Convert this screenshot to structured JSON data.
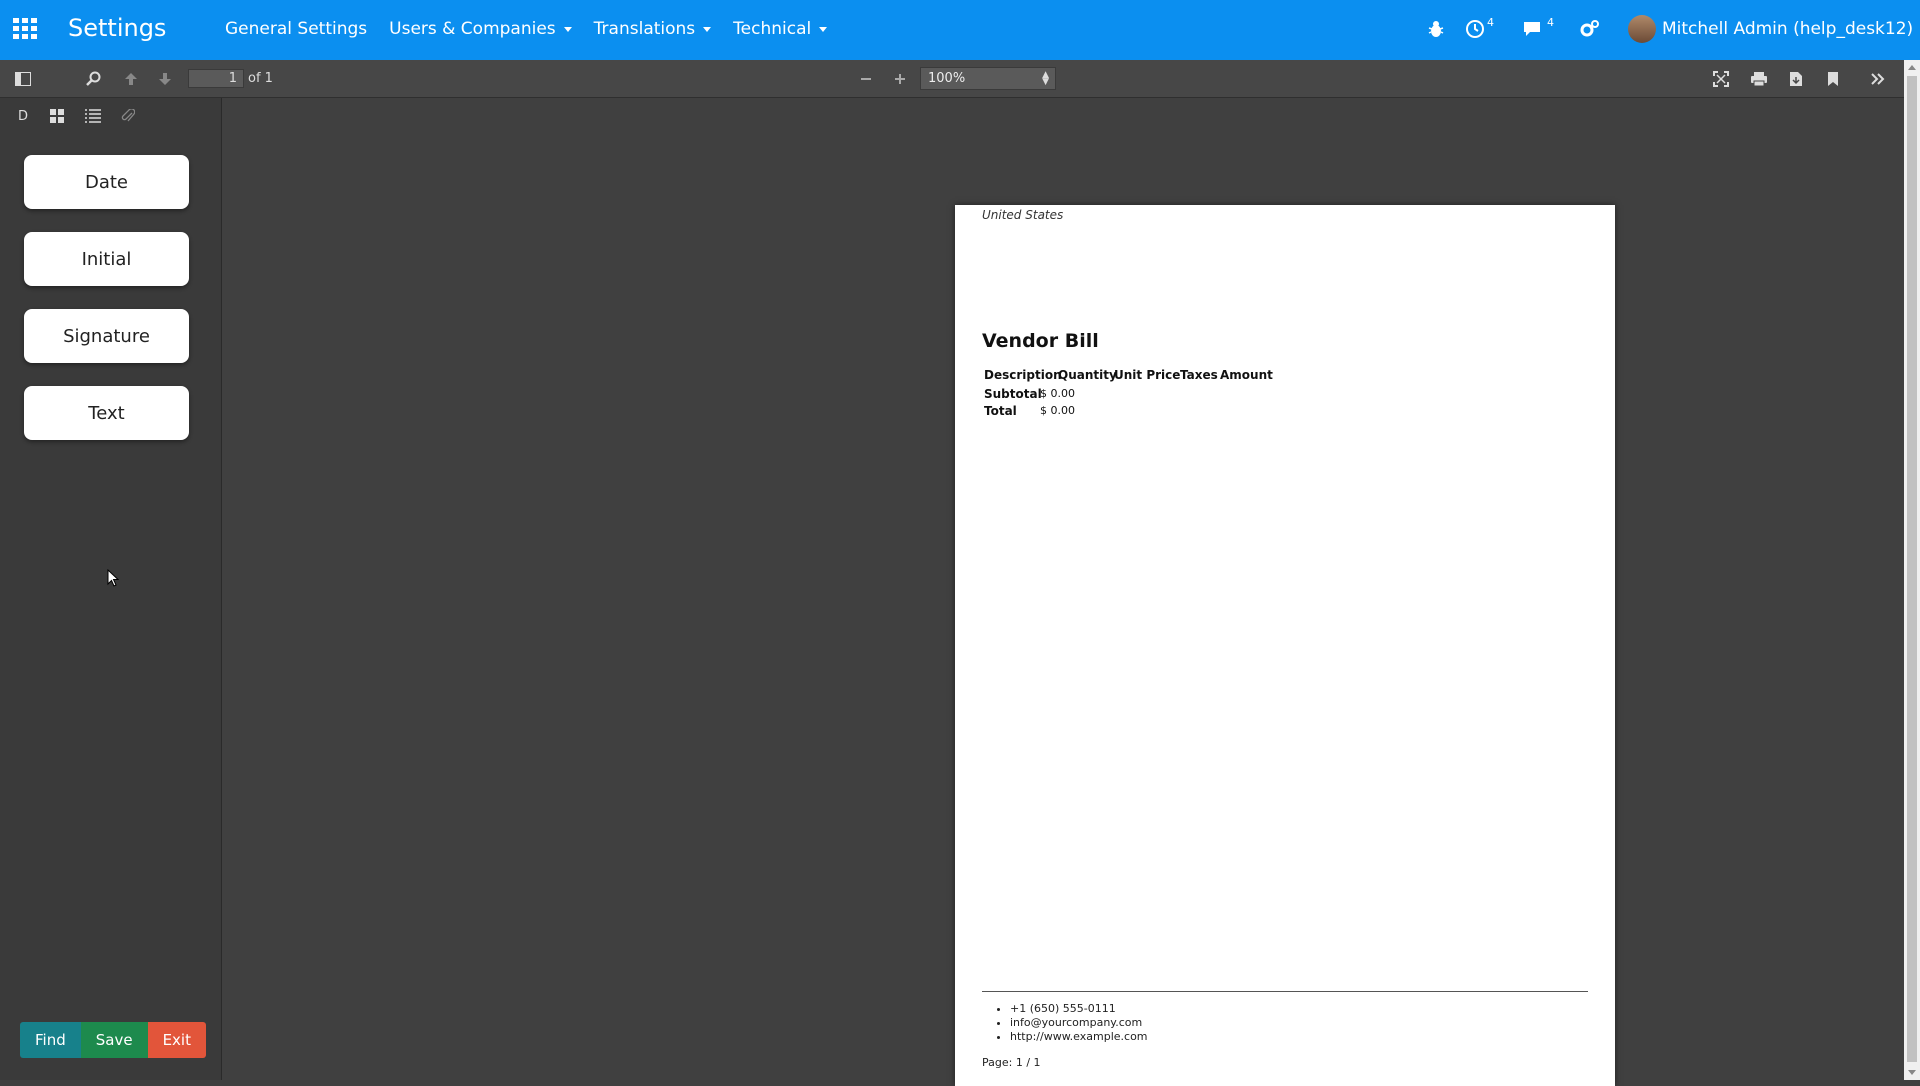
{
  "navbar": {
    "app_title": "Settings",
    "menu": [
      {
        "label": "General Settings",
        "dropdown": false
      },
      {
        "label": "Users & Companies",
        "dropdown": true
      },
      {
        "label": "Translations",
        "dropdown": true
      },
      {
        "label": "Technical",
        "dropdown": true
      }
    ],
    "activity_count": "4",
    "messages_count": "4",
    "user_name": "Mitchell Admin (help_desk12)",
    "bg_color": "#0b8ff0"
  },
  "pdf_toolbar": {
    "page_number": "1",
    "page_of": "of 1",
    "zoom": "100%"
  },
  "sidebar": {
    "tabs": [
      "D",
      "thumbnails",
      "outline",
      "attachments"
    ],
    "fields": [
      "Date",
      "Initial",
      "Signature",
      "Text"
    ],
    "buttons": {
      "find": "Find",
      "save": "Save",
      "exit": "Exit"
    }
  },
  "document": {
    "address": "United States",
    "title": "Vendor Bill",
    "headers": [
      "Description",
      "Quantity",
      "Unit Price",
      "Taxes",
      "Amount"
    ],
    "subtotal_label": "Subtotal",
    "subtotal_value": "$ 0.00",
    "total_label": "Total",
    "total_value": "$ 0.00",
    "footer": [
      "+1 (650) 555-0111",
      "info@yourcompany.com",
      "http://www.example.com"
    ],
    "page_label": "Page: 1 / 1"
  }
}
